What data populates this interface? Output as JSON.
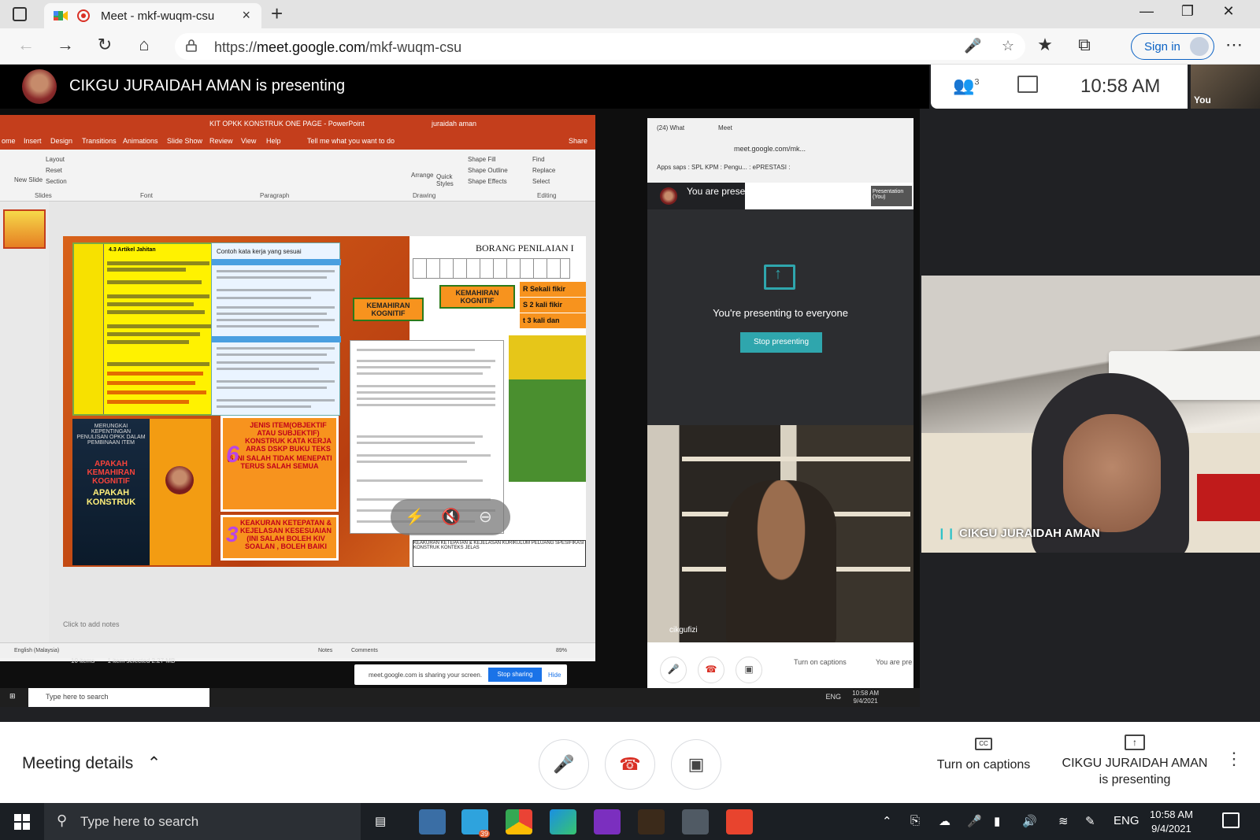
{
  "browser": {
    "tab_title": "Meet - mkf-wuqm-csu",
    "url_prefix": "https://",
    "url_host": "meet.google.com",
    "url_path": "/mkf-wuqm-csu",
    "sign_in": "Sign in",
    "new_tab": "+",
    "close_tab": "×"
  },
  "meet": {
    "presenter_banner": "CIKGU JURAIDAH AMAN is presenting",
    "participants_count": "3",
    "clock": "10:58 AM",
    "self_label": "You",
    "tile_name": "CIKGU JURAIDAH AMAN",
    "meeting_details": "Meeting details",
    "captions_label": "Turn on captions",
    "presenting_line1": "CIKGU JURAIDAH AMAN",
    "presenting_line2": "is presenting",
    "accent": "#1a73e8",
    "end_call_color": "#d93025"
  },
  "shared_screen": {
    "ppt": {
      "title": "KIT OPKK KONSTRUK ONE PAGE  -  PowerPoint",
      "user": "juraidah aman",
      "tabs": [
        "ome",
        "Insert",
        "Design",
        "Transitions",
        "Animations",
        "Slide Show",
        "Review",
        "View",
        "Help",
        "Tell me what you want to do",
        "Share"
      ],
      "groups": [
        "Slides",
        "Font",
        "Paragraph",
        "Drawing",
        "Editing"
      ],
      "ribbon_items": [
        "Layout",
        "Reset",
        "Section",
        "New Slide",
        "Arrange",
        "Quick Styles",
        "Shape Fill",
        "Shape Outline",
        "Shape Effects",
        "Find",
        "Replace",
        "Select"
      ],
      "notes_placeholder": "Click to add notes",
      "status_lang": "English (Malaysia)",
      "status_notes": "Notes",
      "status_comments": "Comments",
      "zoom": "89%",
      "slide": {
        "yellow_header": "4.3 Artikel Jahitan",
        "table_header": "Contoh kata kerja yang sesuai",
        "navy_top": "MERUNGKAI KEPENTINGAN PENULISAN OPKK DALAM PEMBINAAN ITEM",
        "navy_q": "APAKAH KEMAHIRAN KOGNITIF",
        "navy_a": "APAKAH KONSTRUK",
        "orange1_title": "JENIS ITEM(OBJEKTIF ATAU SUBJEKTIF) KONSTRUK KATA KERJA ARAS DSKP BUKU TEKS",
        "orange1_num": "6",
        "orange1_note": "(6 INI SALAH TIDAK MENEPATI TERUS SALAH SEMUA",
        "orange2_title": "KEAKURAN KETEPATAN & KEJELASAN KESESUAIAN",
        "orange2_num": "3",
        "orange2_note": "(INI SALAH BOLEH KIV SOALAN , BOLEH BAIKI",
        "kognitif": "KEMAHIRAN KOGNITIF",
        "borang_title": "BORANG PENILAIAN I",
        "sek": [
          "R  Sekali fikir",
          "S  2 kali fikir",
          "t  3 kali dan"
        ],
        "bottom_tbl": "KEAKURAN   KETEPATAN & KEJELASAN   KURIKULUM  PELUANG  SPESIFIKASI  KONSTRUK  KONTEKS  JELAS"
      }
    },
    "explorer": {
      "items": "10 items",
      "selected": "1 item selected  2.27 MB"
    },
    "sharing_bar": {
      "text": "meet.google.com is sharing your screen.",
      "stop": "Stop sharing",
      "hide": "Hide"
    },
    "sub_meet": {
      "tab1": "(24) What",
      "tab2": "Meet",
      "url": "meet.google.com/mk...",
      "bookmarks": "Apps   saps   : SPL KPM : Pengu...   : ePRESTASI :",
      "you_presenting": "You are presenting",
      "presenting_msg": "You're presenting to everyone",
      "stop_btn": "Stop presenting",
      "video_name": "cikgufizi",
      "captions": "Turn on captions",
      "you_are_pre": "You are pre",
      "presentation_you": "Presentation (You)"
    },
    "taskbar": {
      "search": "Type here to search",
      "lang": "ENG",
      "time": "10:58 AM",
      "date": "9/4/2021"
    }
  },
  "taskbar": {
    "search": "Type here to search",
    "lang": "ENG",
    "time": "10:58 AM",
    "date": "9/4/2021",
    "telegram_badge": "39"
  }
}
